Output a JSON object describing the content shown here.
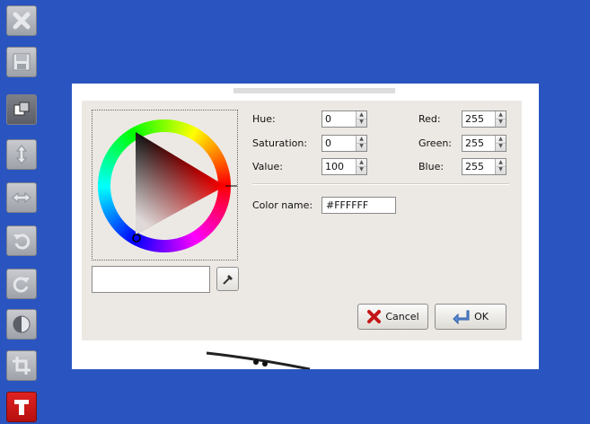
{
  "toolbar": {
    "items": [
      {
        "icon": "close-icon"
      },
      {
        "icon": "save-icon"
      },
      {
        "icon": "copy-icon"
      },
      {
        "icon": "flip-vertical-icon"
      },
      {
        "icon": "flip-horizontal-icon"
      },
      {
        "icon": "rotate-left-icon"
      },
      {
        "icon": "rotate-right-icon"
      },
      {
        "icon": "contrast-icon"
      },
      {
        "icon": "crop-icon"
      },
      {
        "icon": "text-icon"
      }
    ]
  },
  "dialog": {
    "hue_label": "Hue:",
    "saturation_label": "Saturation:",
    "value_label": "Value:",
    "red_label": "Red:",
    "green_label": "Green:",
    "blue_label": "Blue:",
    "hue": "0",
    "saturation": "0",
    "value": "100",
    "red": "255",
    "green": "255",
    "blue": "255",
    "color_name_label": "Color name:",
    "color_name": "#FFFFFF",
    "cancel_label": "Cancel",
    "ok_label": "OK",
    "current_color": "#ffffff"
  },
  "colors": {
    "desktop": "#2a55c0",
    "dialog_bg": "#ece9e4",
    "active_tool": "#d11a1a"
  }
}
